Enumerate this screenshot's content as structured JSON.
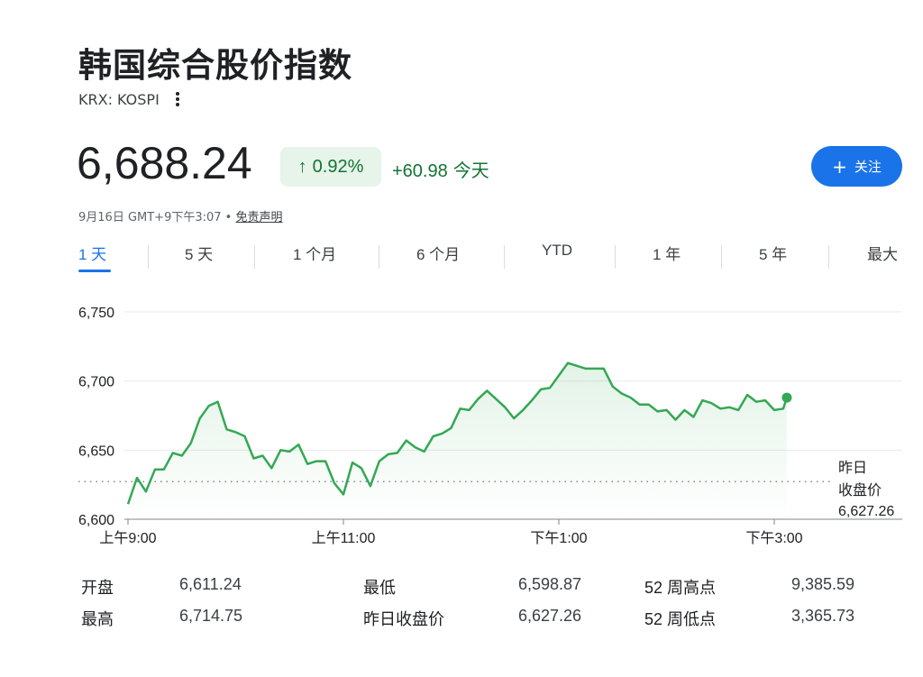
{
  "header": {
    "title": "韩国综合股价指数",
    "ticker": "KRX: KOSPI"
  },
  "quote": {
    "price": "6,688.24",
    "change_pct": "0.92%",
    "change_abs": "+60.98",
    "change_period": "今天",
    "follow_label": "关注",
    "timestamp": "9月16日 GMT+9下午3:07 •",
    "disclaimer": "免责声明"
  },
  "tabs": [
    {
      "label": "1 天"
    },
    {
      "label": "5 天"
    },
    {
      "label": "1 个月"
    },
    {
      "label": "6 个月"
    },
    {
      "label": "YTD"
    },
    {
      "label": "1 年"
    },
    {
      "label": "5 年"
    },
    {
      "label": "最大"
    }
  ],
  "chart_data": {
    "type": "area",
    "ylim": [
      6600,
      6750
    ],
    "yticks": [
      "6,750",
      "6,700",
      "6,650",
      "6,600"
    ],
    "xticks": [
      "上午9:00",
      "上午11:00",
      "下午1:00",
      "下午3:00"
    ],
    "prev_close": 6627.26,
    "prev_close_label": [
      "昨日",
      "收盘价",
      "6,627.26"
    ],
    "series": [
      {
        "color": "#34a853",
        "points": [
          [
            "09:00",
            6611
          ],
          [
            "09:05",
            6630
          ],
          [
            "09:10",
            6620
          ],
          [
            "09:15",
            6636
          ],
          [
            "09:20",
            6636
          ],
          [
            "09:25",
            6648
          ],
          [
            "09:30",
            6646
          ],
          [
            "09:35",
            6655
          ],
          [
            "09:40",
            6673
          ],
          [
            "09:45",
            6682
          ],
          [
            "09:50",
            6685
          ],
          [
            "09:55",
            6665
          ],
          [
            "10:00",
            6663
          ],
          [
            "10:05",
            6660
          ],
          [
            "10:10",
            6644
          ],
          [
            "10:15",
            6646
          ],
          [
            "10:20",
            6637
          ],
          [
            "10:25",
            6650
          ],
          [
            "10:30",
            6649
          ],
          [
            "10:35",
            6654
          ],
          [
            "10:40",
            6640
          ],
          [
            "10:45",
            6642
          ],
          [
            "10:50",
            6642
          ],
          [
            "10:55",
            6626
          ],
          [
            "11:00",
            6618
          ],
          [
            "11:05",
            6641
          ],
          [
            "11:10",
            6637
          ],
          [
            "11:15",
            6624
          ],
          [
            "11:20",
            6642
          ],
          [
            "11:25",
            6647
          ],
          [
            "11:30",
            6648
          ],
          [
            "11:35",
            6657
          ],
          [
            "11:40",
            6652
          ],
          [
            "11:45",
            6649
          ],
          [
            "11:50",
            6660
          ],
          [
            "11:55",
            6662
          ],
          [
            "12:00",
            6666
          ],
          [
            "12:05",
            6680
          ],
          [
            "12:10",
            6679
          ],
          [
            "12:15",
            6687
          ],
          [
            "12:20",
            6693
          ],
          [
            "12:25",
            6687
          ],
          [
            "12:30",
            6681
          ],
          [
            "12:35",
            6673
          ],
          [
            "12:40",
            6679
          ],
          [
            "12:45",
            6686
          ],
          [
            "12:50",
            6694
          ],
          [
            "12:55",
            6695
          ],
          [
            "13:00",
            6704
          ],
          [
            "13:05",
            6713
          ],
          [
            "13:10",
            6711
          ],
          [
            "13:15",
            6709
          ],
          [
            "13:20",
            6709
          ],
          [
            "13:25",
            6709
          ],
          [
            "13:30",
            6696
          ],
          [
            "13:35",
            6691
          ],
          [
            "13:40",
            6688
          ],
          [
            "13:45",
            6683
          ],
          [
            "13:50",
            6683
          ],
          [
            "13:55",
            6678
          ],
          [
            "14:00",
            6679
          ],
          [
            "14:05",
            6672
          ],
          [
            "14:10",
            6679
          ],
          [
            "14:15",
            6674
          ],
          [
            "14:20",
            6686
          ],
          [
            "14:25",
            6684
          ],
          [
            "14:30",
            6680
          ],
          [
            "14:35",
            6681
          ],
          [
            "14:40",
            6679
          ],
          [
            "14:45",
            6690
          ],
          [
            "14:50",
            6685
          ],
          [
            "14:55",
            6686
          ],
          [
            "15:00",
            6679
          ],
          [
            "15:05",
            6680
          ],
          [
            "15:07",
            6688
          ]
        ]
      }
    ]
  },
  "stats": [
    {
      "label": "开盘",
      "value": "6,611.24"
    },
    {
      "label": "最低",
      "value": "6,598.87"
    },
    {
      "label": "52 周高点",
      "value": "9,385.59"
    },
    {
      "label": "最高",
      "value": "6,714.75"
    },
    {
      "label": "昨日收盘价",
      "value": "6,627.26"
    },
    {
      "label": "52 周低点",
      "value": "3,365.73"
    }
  ]
}
